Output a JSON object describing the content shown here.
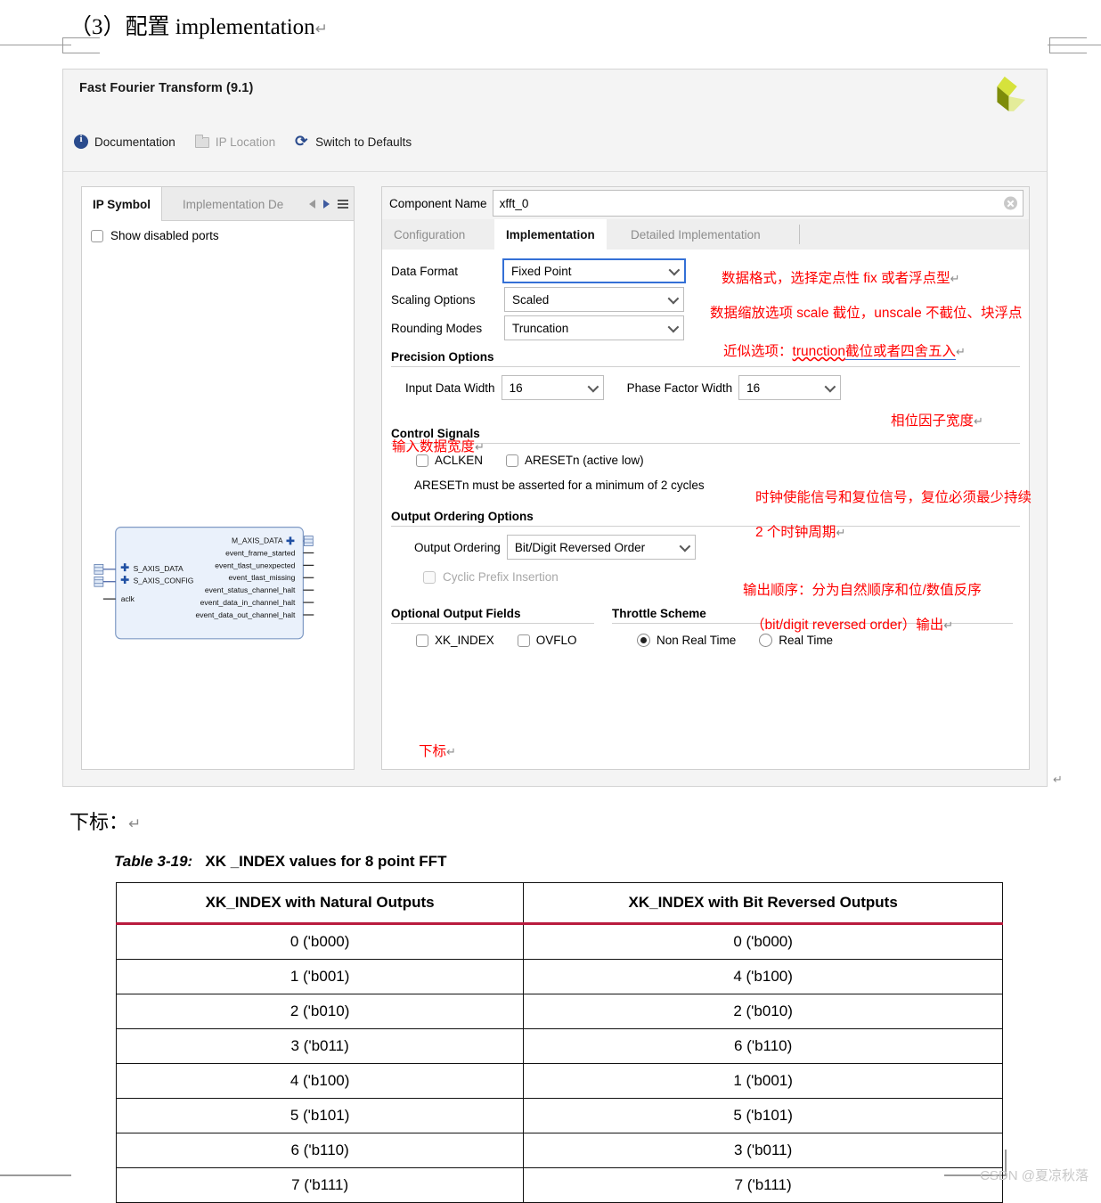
{
  "document": {
    "heading": "（3）配置 implementation",
    "subhead": "下标：",
    "pilcrow": "↵"
  },
  "dialog": {
    "title": "Fast Fourier Transform (9.1)",
    "logo_name": "xilinx-logo",
    "toolbar": [
      {
        "label": "Documentation",
        "icon": "info-icon",
        "disabled": false
      },
      {
        "label": "IP Location",
        "icon": "folder-icon",
        "disabled": true
      },
      {
        "label": "Switch to Defaults",
        "icon": "refresh-icon",
        "disabled": false
      }
    ],
    "left_panel": {
      "tabs": [
        {
          "label": "IP Symbol",
          "active": true
        },
        {
          "label": "Implementation De",
          "active": false
        }
      ],
      "show_disabled_ports": "Show disabled ports",
      "symbol": {
        "left_ports": [
          "S_AXIS_DATA",
          "S_AXIS_CONFIG",
          "aclk"
        ],
        "right_ports": [
          "M_AXIS_DATA",
          "event_frame_started",
          "event_tlast_unexpected",
          "event_tlast_missing",
          "event_status_channel_halt",
          "event_data_in_channel_halt",
          "event_data_out_channel_halt"
        ]
      }
    },
    "component": {
      "label": "Component Name",
      "value": "xfft_0",
      "clear_icon": "clear-icon"
    },
    "tabs": [
      {
        "label": "Configuration",
        "active": false
      },
      {
        "label": "Implementation",
        "active": true
      },
      {
        "label": "Detailed Implementation",
        "active": false
      }
    ],
    "fields": [
      {
        "label": "Data Format",
        "value": "Fixed Point",
        "focused": true
      },
      {
        "label": "Scaling Options",
        "value": "Scaled",
        "focused": false
      },
      {
        "label": "Rounding Modes",
        "value": "Truncation",
        "focused": false
      }
    ],
    "precision": {
      "title": "Precision Options",
      "input_data_width": {
        "label": "Input Data Width",
        "value": "16"
      },
      "phase_factor_width": {
        "label": "Phase Factor Width",
        "value": "16"
      }
    },
    "control_signals": {
      "title": "Control Signals",
      "aclken": {
        "label": "ACLKEN",
        "checked": false
      },
      "aresetn": {
        "label": "ARESETn (active low)",
        "checked": false
      },
      "note": "ARESETn must be asserted for a minimum of 2 cycles"
    },
    "output_ordering": {
      "title": "Output Ordering Options",
      "label": "Output Ordering",
      "value": "Bit/Digit Reversed Order",
      "cyclic_prefix": {
        "label": "Cyclic Prefix Insertion",
        "checked": false,
        "disabled": true
      }
    },
    "optional_output_fields": {
      "title": "Optional Output Fields",
      "xk_index": {
        "label": "XK_INDEX",
        "checked": false
      },
      "ovflo": {
        "label": "OVFLO",
        "checked": false
      }
    },
    "throttle_scheme": {
      "title": "Throttle Scheme",
      "non_real_time": {
        "label": "Non Real Time",
        "selected": true
      },
      "real_time": {
        "label": "Real Time",
        "selected": false
      }
    }
  },
  "annotations": [
    {
      "id": "data-format",
      "text": "数据格式，选择定点性 fix 或者浮点型",
      "cr": "↵"
    },
    {
      "id": "scaling",
      "text": "数据缩放选项 scale 截位，unscale 不截位、块浮点",
      "cr": ""
    },
    {
      "id": "rounding-a",
      "text": "近似选项：",
      "cr": ""
    },
    {
      "id": "rounding-b",
      "text": "trunction",
      "cr": ""
    },
    {
      "id": "rounding-c",
      "text": "截位或者四舍五入",
      "cr": "↵"
    },
    {
      "id": "input-width",
      "text": "输入数据宽度",
      "cr": "↵"
    },
    {
      "id": "phase-width",
      "text": "相位因子宽度",
      "cr": "↵"
    },
    {
      "id": "control-signals-1",
      "text": "时钟使能信号和复位信号，复位必须最少持续",
      "cr": ""
    },
    {
      "id": "control-signals-2",
      "text": "2 个时钟周期",
      "cr": "↵"
    },
    {
      "id": "output-order-1",
      "text": "输出顺序：分为自然顺序和位/数值反序",
      "cr": ""
    },
    {
      "id": "output-order-2",
      "text": "（bit/digit reversed order）输出",
      "cr": "↵"
    },
    {
      "id": "xk-index",
      "text": "下标",
      "cr": "↵"
    },
    {
      "id": "dialog-end",
      "text": "",
      "cr": "↵"
    }
  ],
  "table": {
    "caption_prefix": "Table 3-19:",
    "caption_text": "XK _INDEX values for 8 point FFT",
    "headers": [
      "XK_INDEX with Natural Outputs",
      "XK_INDEX with Bit Reversed Outputs"
    ],
    "rows": [
      [
        "0 ('b000)",
        "0 ('b000)"
      ],
      [
        "1 ('b001)",
        "4 ('b100)"
      ],
      [
        "2 ('b010)",
        "2 ('b010)"
      ],
      [
        "3 ('b011)",
        "6 ('b110)"
      ],
      [
        "4 ('b100)",
        "1 ('b001)"
      ],
      [
        "5 ('b101)",
        "5 ('b101)"
      ],
      [
        "6 ('b110)",
        "3 ('b011)"
      ],
      [
        "7 ('b111)",
        "7 ('b111)"
      ]
    ],
    "header_rule_color": "#b91b3e"
  },
  "watermark": "CSDN @夏凉秋落"
}
